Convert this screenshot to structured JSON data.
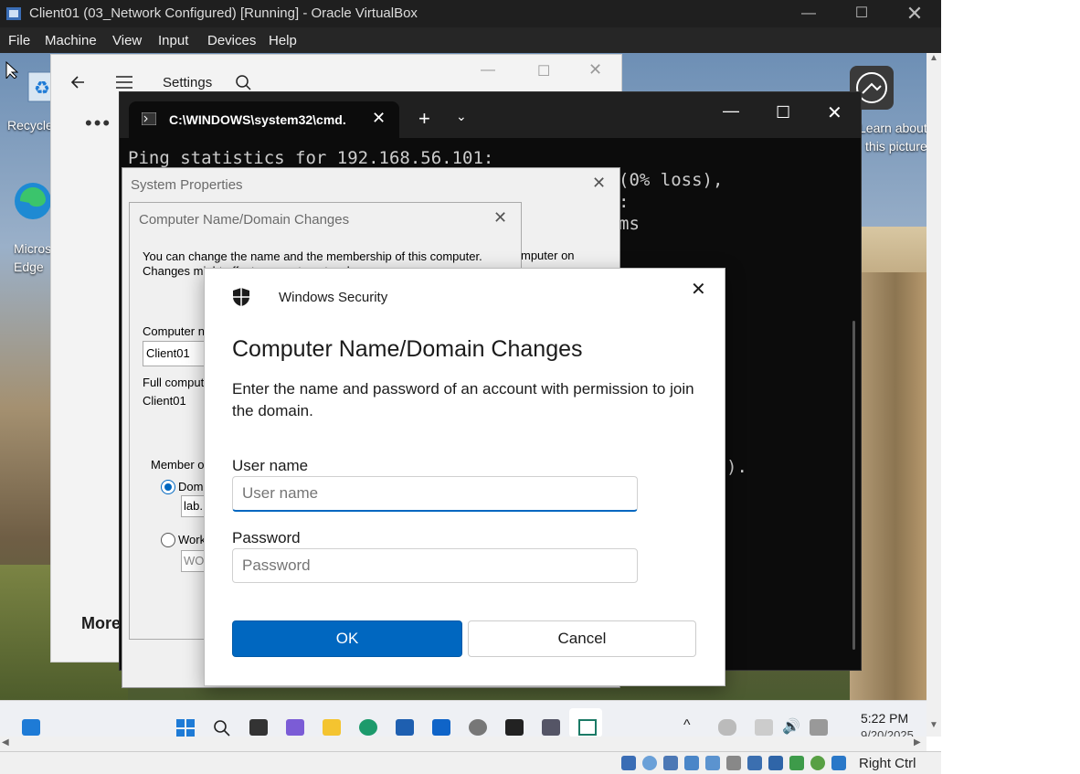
{
  "host": {
    "title": "Client01 (03_Network Configured) [Running] - Oracle VirtualBox",
    "menu": [
      "File",
      "Machine",
      "View",
      "Input",
      "Devices",
      "Help"
    ],
    "status_label": "Right Ctrl"
  },
  "desktop": {
    "icons": [
      "Recycle",
      "Microsoft\nEdge"
    ],
    "spotlight_label": "Learn about\nthis picture"
  },
  "settings_window": {
    "title": "Settings",
    "section": "More"
  },
  "terminal": {
    "tab_title": "C:\\WINDOWS\\system32\\cmd.",
    "lines": [
      "Ping statistics for 192.168.56.101:",
      "(0% loss),",
      ":",
      "ms"
    ],
    "tail": ")."
  },
  "system_properties": {
    "title": "System Properties"
  },
  "cndc_dialog": {
    "title": "Computer Name/Domain Changes",
    "intro_line1": "You can change the name and the membership of this computer.",
    "intro_line2": "Changes might affect access to network resources.",
    "computer_name_label": "Computer n",
    "computer_name_value": "Client01",
    "full_name_label": "Full comput",
    "full_name_value": "Client01",
    "member_label": "Member o",
    "domain_label": "Dom",
    "domain_value": "lab.",
    "workgroup_label": "Work",
    "workgroup_value": "WO",
    "side_text": "mputer on"
  },
  "security_dialog": {
    "header": "Windows Security",
    "title": "Computer Name/Domain Changes",
    "description": "Enter the name and password of an account with permission to join the domain.",
    "username_label": "User name",
    "username_placeholder": "User name",
    "password_label": "Password",
    "password_placeholder": "Password",
    "ok_label": "OK",
    "cancel_label": "Cancel"
  },
  "taskbar": {
    "time": "5:22 PM",
    "date": "9/20/2025"
  },
  "colors": {
    "accent": "#0067c0",
    "host_bar": "#1f1f1f"
  }
}
